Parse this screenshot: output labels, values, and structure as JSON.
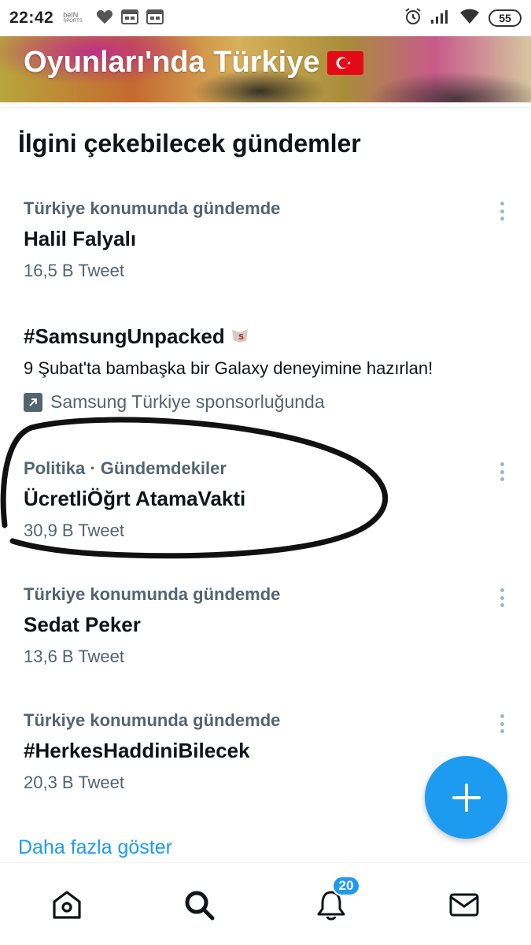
{
  "status_bar": {
    "time": "22:42",
    "bein_top": "beIN",
    "bein_bottom": "SPORTS",
    "battery": "55",
    "icons": [
      "heart-icon",
      "calendar-icon",
      "calendar-icon",
      "alarm-icon",
      "signal-icon",
      "wifi-icon",
      "battery-icon"
    ]
  },
  "banner": {
    "title": "Oyunları'nda Türkiye"
  },
  "section": {
    "title": "İlgini çekebilecek gündemler"
  },
  "trends": [
    {
      "meta": "Türkiye konumunda gündemde",
      "name": "Halil Falyalı",
      "count": "16,5 B Tweet"
    },
    {
      "meta": "Politika · Gündemdekiler",
      "name": "ÜcretliÖğrt AtamaVakti",
      "count": "30,9 B Tweet"
    },
    {
      "meta": "Türkiye konumunda gündemde",
      "name": "Sedat Peker",
      "count": "13,6 B Tweet"
    },
    {
      "meta": "Türkiye konumunda gündemde",
      "name": "#HerkesHaddiniBilecek",
      "count": "20,3 B Tweet"
    }
  ],
  "promoted": {
    "name": "#SamsungUnpacked",
    "description": "9 Şubat'ta bambaşka bir Galaxy deneyimine hazırlan!",
    "sponsor": "Samsung Türkiye sponsorluğunda"
  },
  "show_more": "Daha fazla göster",
  "nav": {
    "notifications_badge": "20"
  },
  "colors": {
    "accent": "#1d9bf0",
    "secondary_text": "#536471",
    "primary_text": "#0f1419"
  }
}
